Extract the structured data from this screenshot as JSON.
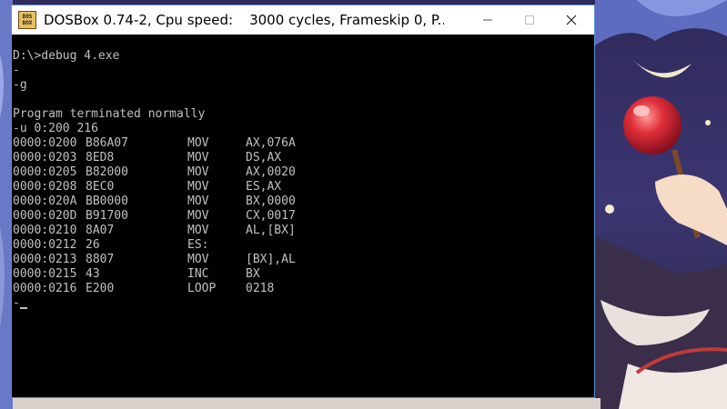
{
  "window": {
    "icon_text_top": "DOS",
    "icon_text_bottom": "BOX",
    "title_app": "DOSBox 0.74-2, Cpu speed:",
    "title_stats": "3000 cycles, Frameskip  0, P...",
    "minimize": "—",
    "maximize": "☐",
    "close": "✕"
  },
  "console": {
    "pre_lines": [
      "D:\\>debug 4.exe",
      "-",
      "-g",
      "",
      "Program terminated normally",
      "-u 0:200 216"
    ],
    "disassembly": [
      {
        "addr": "0000:0200",
        "hex": "B86A07",
        "mnemonic": "MOV",
        "operands": "AX,076A"
      },
      {
        "addr": "0000:0203",
        "hex": "8ED8",
        "mnemonic": "MOV",
        "operands": "DS,AX"
      },
      {
        "addr": "0000:0205",
        "hex": "B82000",
        "mnemonic": "MOV",
        "operands": "AX,0020"
      },
      {
        "addr": "0000:0208",
        "hex": "8EC0",
        "mnemonic": "MOV",
        "operands": "ES,AX"
      },
      {
        "addr": "0000:020A",
        "hex": "BB0000",
        "mnemonic": "MOV",
        "operands": "BX,0000"
      },
      {
        "addr": "0000:020D",
        "hex": "B91700",
        "mnemonic": "MOV",
        "operands": "CX,0017"
      },
      {
        "addr": "0000:0210",
        "hex": "8A07",
        "mnemonic": "MOV",
        "operands": "AL,[BX]"
      },
      {
        "addr": "0000:0212",
        "hex": "26",
        "mnemonic": "ES:",
        "operands": ""
      },
      {
        "addr": "0000:0213",
        "hex": "8807",
        "mnemonic": "MOV",
        "operands": "[BX],AL"
      },
      {
        "addr": "0000:0215",
        "hex": "43",
        "mnemonic": "INC",
        "operands": "BX"
      },
      {
        "addr": "0000:0216",
        "hex": "E200",
        "mnemonic": "LOOP",
        "operands": "0218"
      }
    ],
    "prompt": "-"
  },
  "colors": {
    "console_bg": "#000000",
    "console_fg": "#c0c0c0",
    "titlebar_bg": "#ffffff",
    "window_border": "#5a8fd0"
  }
}
